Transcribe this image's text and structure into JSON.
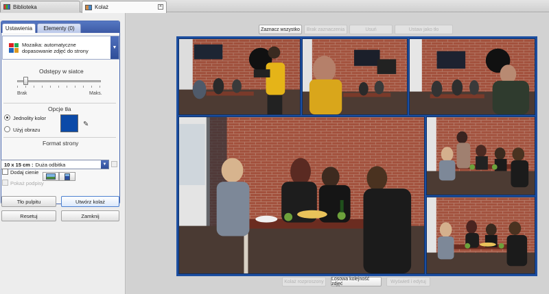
{
  "tabs": [
    {
      "label": "Biblioteka",
      "active": false
    },
    {
      "label": "Kolaż",
      "active": true
    }
  ],
  "panel": {
    "tabs": [
      "Ustawienia",
      "Elementy (0)"
    ],
    "layout_select": "Mozaika: automatyczne dopasowanie zdjęć do strony",
    "spacing": {
      "title": "Odstępy w siatce",
      "min_label": "Brak",
      "max_label": "Maks.",
      "value_fraction": 0.1
    },
    "background": {
      "title": "Opcje tła",
      "solid_label": "Jednolity kolor",
      "image_label": "Użyj obrazu",
      "selected": "solid",
      "color": "#0b4aa8"
    },
    "page_format": {
      "title": "Format strony",
      "size": "10 x 15 cm :",
      "name": "Duża odbitka"
    },
    "add_shadows": "Dodaj cienie",
    "show_captions": "Pokaż podpisy"
  },
  "buttons": {
    "desktop_bg": "Tło pulpitu",
    "create_collage": "Utwórz kolaż",
    "reset": "Resetuj",
    "close": "Zamknij"
  },
  "main": {
    "top_buttons": [
      {
        "label": "Zaznacz wszystko",
        "enabled": true
      },
      {
        "label": "Brak zaznaczenia",
        "enabled": false
      },
      {
        "label": "Usuń",
        "enabled": false
      },
      {
        "label": "Ustaw jako tło",
        "enabled": false
      }
    ],
    "bottom_buttons": [
      {
        "label": "Kolaż rozproszony",
        "enabled": false
      },
      {
        "label": "Losowa kolejność zdjęć",
        "enabled": true
      },
      {
        "label": "Wyświetl i edytuj",
        "enabled": false
      }
    ],
    "canvas_color": "#1c4ea0"
  }
}
